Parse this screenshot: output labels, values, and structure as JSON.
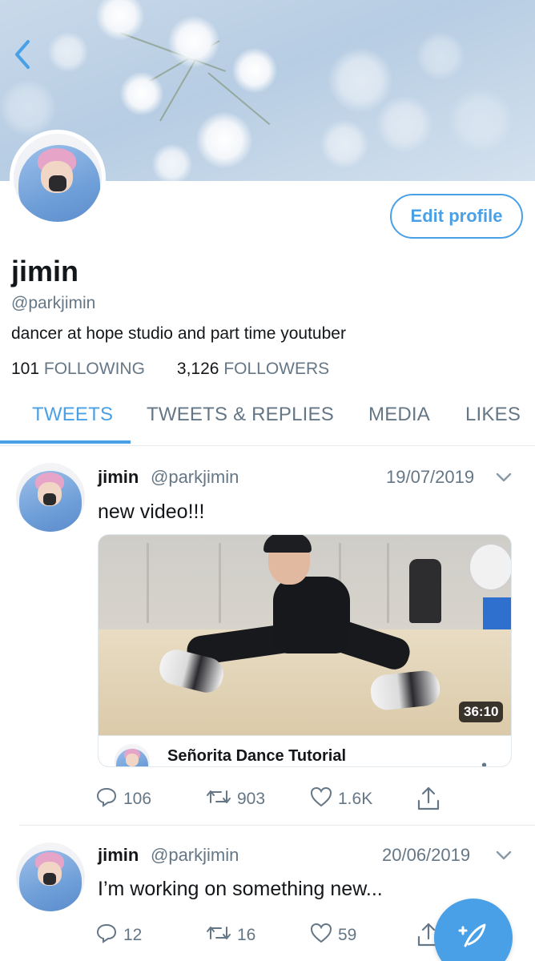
{
  "profile": {
    "edit_label": "Edit profile",
    "name": "jimin",
    "handle": "@parkjimin",
    "bio": "dancer at hope studio and part time youtuber",
    "following_count": "101",
    "following_label": "FOLLOWING",
    "followers_count": "3,126",
    "followers_label": "FOLLOWERS"
  },
  "tabs": [
    {
      "label": "TWEETS",
      "active": true
    },
    {
      "label": "TWEETS & REPLIES",
      "active": false
    },
    {
      "label": "MEDIA",
      "active": false
    },
    {
      "label": "LIKES",
      "active": false
    }
  ],
  "tweets": [
    {
      "name": "jimin",
      "handle": "@parkjimin",
      "date": "19/07/2019",
      "text": "new video!!!",
      "media": {
        "duration": "36:10",
        "card_title": "Señorita Dance Tutorial"
      },
      "replies": "106",
      "retweets": "903",
      "likes": "1.6K"
    },
    {
      "name": "jimin",
      "handle": "@parkjimin",
      "date": "20/06/2019",
      "text": "I’m working on something new...",
      "replies": "12",
      "retweets": "16",
      "likes": "59"
    }
  ],
  "colors": {
    "accent": "#4aa0e6",
    "secondary_text": "#657786",
    "primary_text": "#14171a"
  },
  "icons": {
    "back": "chevron-left-icon",
    "reply": "reply-icon",
    "retweet": "retweet-icon",
    "like": "heart-icon",
    "share": "share-icon",
    "compose": "compose-tweet-icon",
    "more": "chevron-down-icon"
  }
}
